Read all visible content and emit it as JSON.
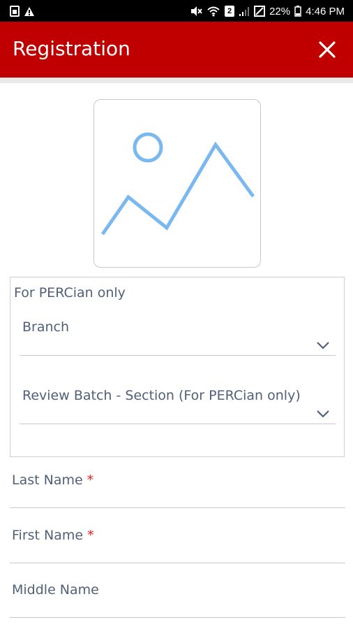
{
  "status_bar": {
    "battery": "22%",
    "time": "4:46 PM",
    "sim_badge": "2"
  },
  "app_bar": {
    "title": "Registration",
    "close_icon": "close-icon"
  },
  "photo": {
    "icon": "image-placeholder-icon"
  },
  "percian_group": {
    "label": "For PERCian only",
    "branch": {
      "label": "Branch"
    },
    "review_batch": {
      "label": "Review Batch - Section (For PERCian only)"
    }
  },
  "fields": {
    "last_name": {
      "label": "Last Name",
      "required_mark": "*"
    },
    "first_name": {
      "label": "First Name",
      "required_mark": "*"
    },
    "middle_name": {
      "label": "Middle Name"
    }
  },
  "colors": {
    "app_bar": "#c00000",
    "label_text": "#51607a",
    "required": "#e02020",
    "placeholder_icon": "#7ab8f0"
  }
}
